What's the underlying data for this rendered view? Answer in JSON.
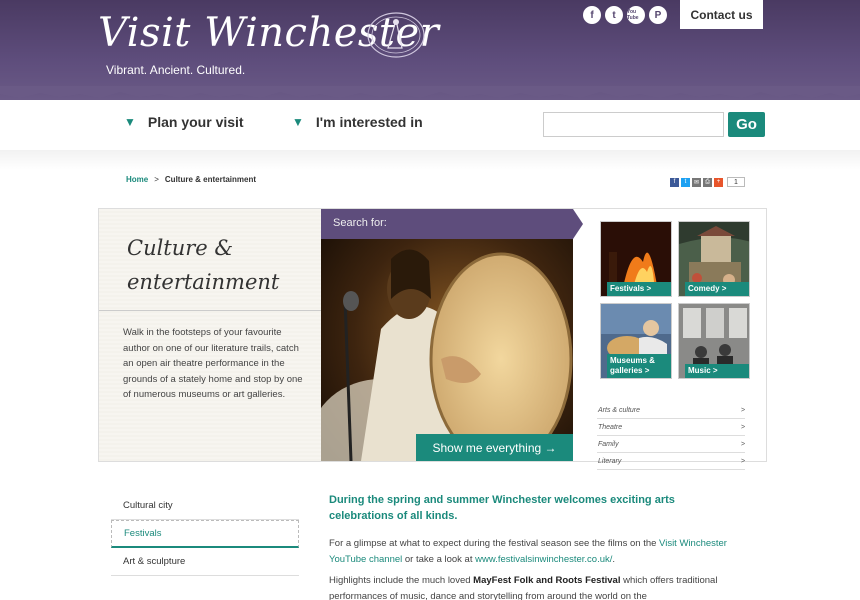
{
  "header": {
    "logo": "Visit Winchester",
    "tagline": "Vibrant. Ancient. Cultured.",
    "contact_label": "Contact us",
    "social": [
      "f",
      "t",
      "You Tube",
      "P"
    ]
  },
  "nav": {
    "plan_label": "Plan your visit",
    "interest_label": "I'm interested in",
    "search_value": "",
    "go_label": "Go"
  },
  "breadcrumb": {
    "home": "Home",
    "separator": ">",
    "current": "Culture & entertainment"
  },
  "share": {
    "count": "1"
  },
  "intro": {
    "title": "Culture & entertainment",
    "text": "Walk in the footsteps of your favourite author on one of our literature trails, catch an open air theatre performance in the grounds of a stately home and stop by one of numerous museums or art galleries."
  },
  "feature": {
    "search_label": "Search for:",
    "show_label": "Show me everything →"
  },
  "categories": {
    "tiles": [
      {
        "label": "Festivals >"
      },
      {
        "label": "Comedy >"
      },
      {
        "label": "Museums & galleries >"
      },
      {
        "label": "Music >"
      }
    ],
    "list": [
      {
        "label": "Arts & culture",
        "arrow": ">"
      },
      {
        "label": "Theatre",
        "arrow": ">"
      },
      {
        "label": "Family",
        "arrow": ">"
      },
      {
        "label": "Literary",
        "arrow": ">"
      }
    ]
  },
  "sidebar": {
    "items": [
      {
        "label": "Cultural city"
      },
      {
        "label": "Festivals"
      },
      {
        "label": "Art & sculpture"
      }
    ]
  },
  "content": {
    "lead": "During the spring and summer Winchester welcomes exciting arts celebrations of all kinds.",
    "p1_a": "For a glimpse at what to expect during the festival season see the films on the ",
    "p1_link1": "Visit Winchester YouTube channel",
    "p1_b": " or take a look at ",
    "p1_link2": "www.festivalsinwinchester.co.uk/",
    "p1_c": ".",
    "p2_a": "Highlights include the much loved ",
    "p2_bold": "MayFest Folk and Roots Festival",
    "p2_b": " which offers traditional performances of music, dance and storytelling from around the world on the"
  },
  "colors": {
    "header": "#5e4d7c",
    "accent": "#1b8a7c"
  }
}
